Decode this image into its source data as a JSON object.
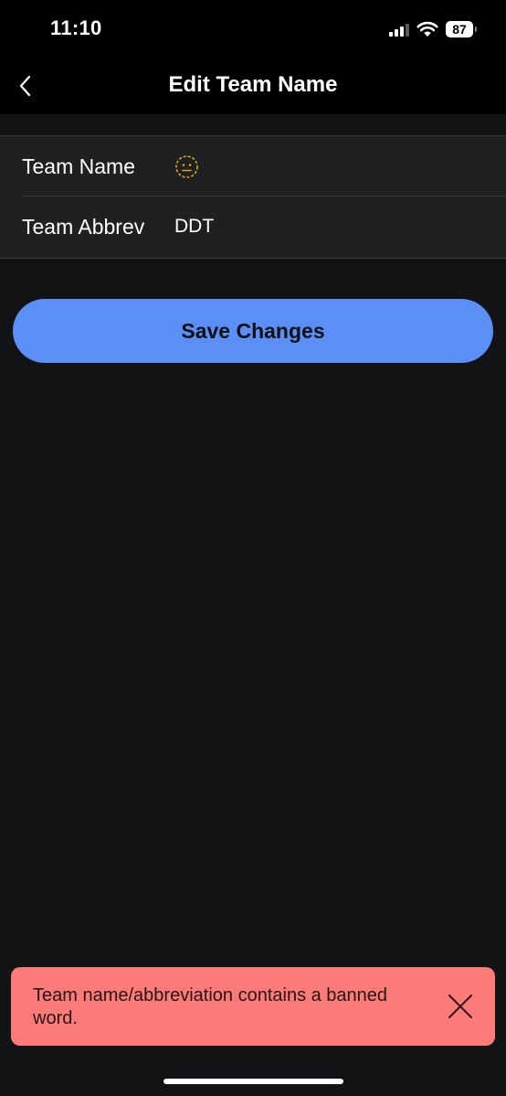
{
  "status_bar": {
    "time": "11:10",
    "battery_level": "87",
    "icons": [
      "signal-icon",
      "wifi-icon",
      "battery-icon"
    ]
  },
  "header": {
    "title": "Edit Team Name",
    "back_icon": "chevron-left-icon"
  },
  "form": {
    "team_name": {
      "label": "Team Name",
      "value_icon": "neutral-face-emoji-icon"
    },
    "team_abbrev": {
      "label": "Team Abbrev",
      "value": "DDT"
    }
  },
  "actions": {
    "save_label": "Save Changes"
  },
  "toast": {
    "message": "Team name/abbreviation contains a banned word.",
    "close_icon": "close-icon"
  },
  "colors": {
    "background": "#121315",
    "bar_background": "#000000",
    "card_background": "#1f2022",
    "accent_button": "#5b8ff5",
    "toast_error": "#fa7b78",
    "emoji_outline": "#e0a11b"
  }
}
